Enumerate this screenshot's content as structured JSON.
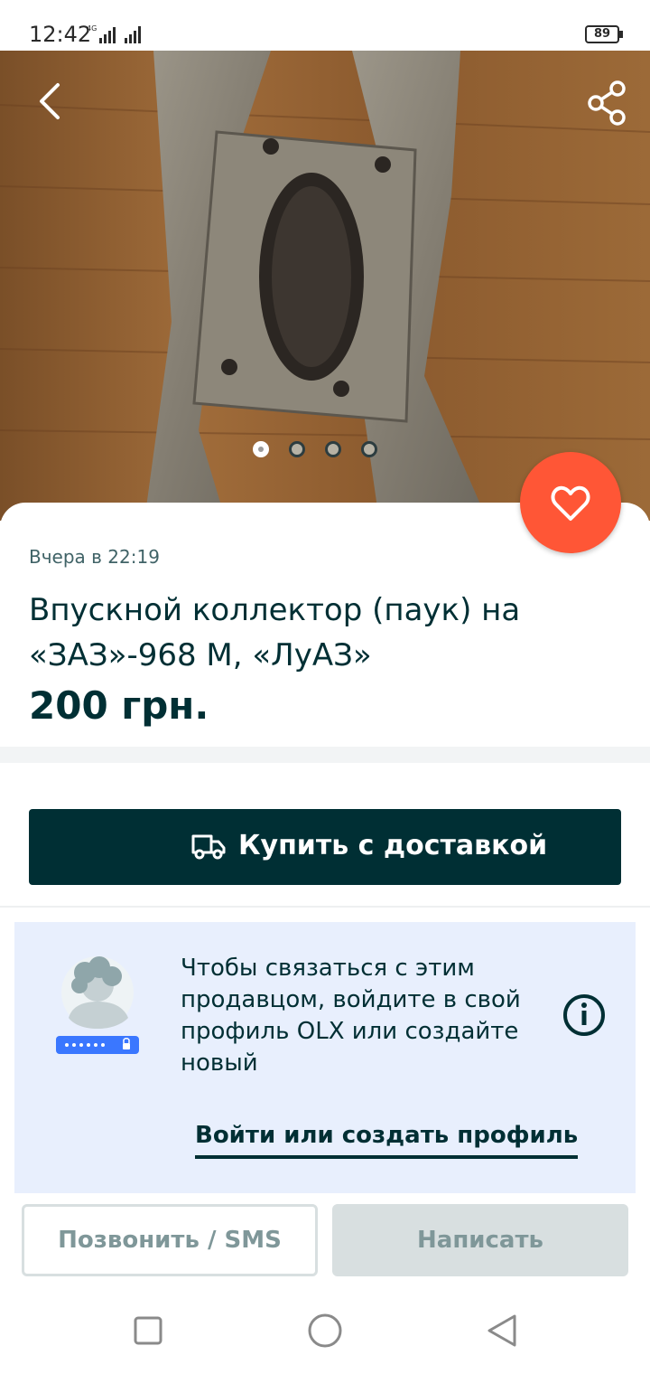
{
  "status_bar": {
    "time": "12:42",
    "network": "4G",
    "battery": "89"
  },
  "gallery": {
    "photo_count": 4,
    "active_index": 0
  },
  "listing": {
    "posted": "Вчера в 22:19",
    "title": "Впускной коллектор (паук) на «ЗАЗ»-968 М, «ЛуАЗ»",
    "price": "200 грн."
  },
  "actions": {
    "buy_label": "Купить с доставкой",
    "call_label": "Позвонить / SMS",
    "write_label": "Написать"
  },
  "login_prompt": {
    "message": "Чтобы связаться с этим продавцом, войдите в свой профиль OLX или создайте новый",
    "link_label": "Войти или создать профиль"
  },
  "colors": {
    "accent_dark": "#002f34",
    "favorite": "#ff5636",
    "panel_bg": "#e8effd"
  }
}
